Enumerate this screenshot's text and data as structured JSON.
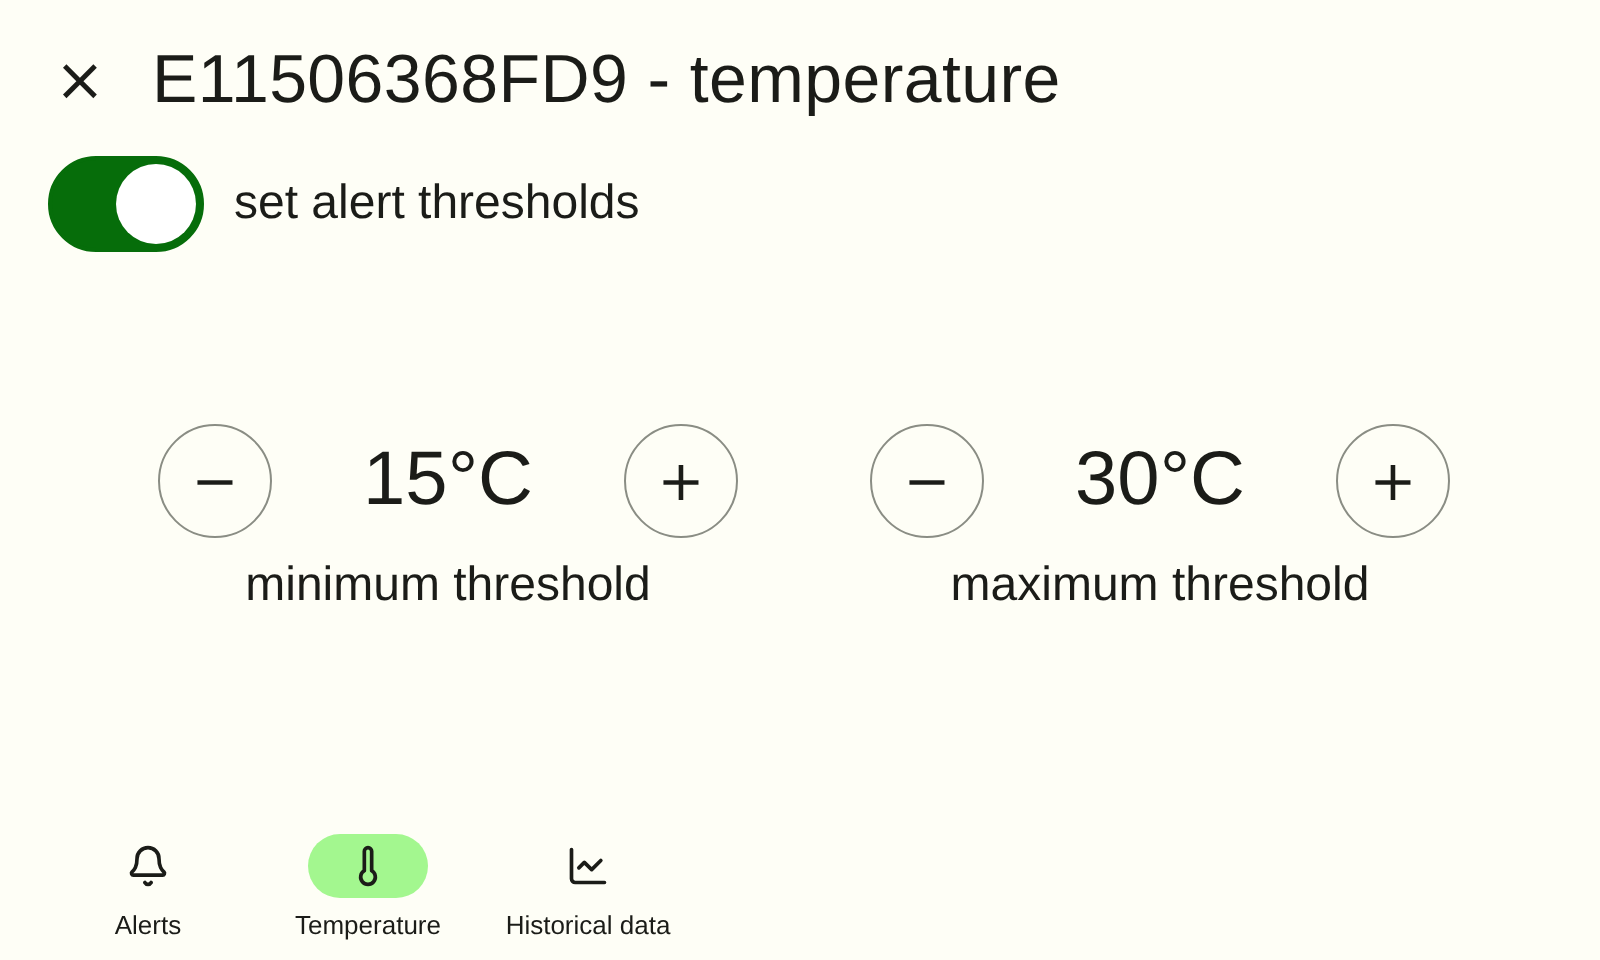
{
  "header": {
    "close": "×",
    "title": "E11506368FD9 - temperature"
  },
  "alert_toggle": {
    "label": "set alert thresholds",
    "on": true
  },
  "thresholds": [
    {
      "decrease": "−",
      "value": "15°C",
      "increase": "+",
      "label": "minimum threshold"
    },
    {
      "decrease": "−",
      "value": "30°C",
      "increase": "+",
      "label": "maximum threshold"
    }
  ],
  "nav": [
    {
      "label": "Alerts",
      "selected": false
    },
    {
      "label": "Temperature",
      "selected": true
    },
    {
      "label": "Historical data",
      "selected": false
    }
  ]
}
